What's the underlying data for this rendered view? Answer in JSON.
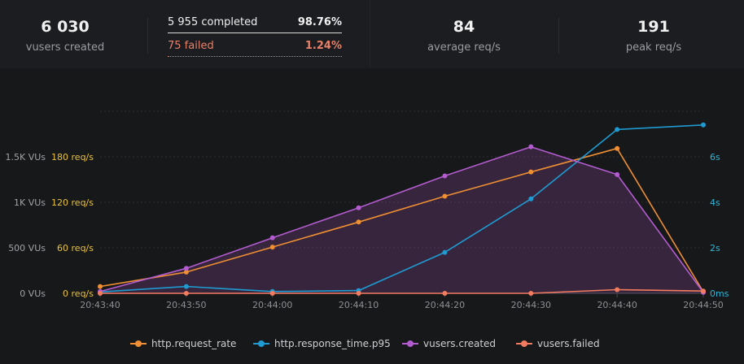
{
  "stats": {
    "vusers_created": {
      "value": "6 030",
      "label": "vusers created"
    },
    "completed": {
      "label": "5 955 completed",
      "percent": "98.76%"
    },
    "failed": {
      "label": "75 failed",
      "percent": "1.24%"
    },
    "average": {
      "value": "84",
      "label": "average req/s"
    },
    "peak": {
      "value": "191",
      "label": "peak req/s"
    }
  },
  "colors": {
    "request_rate": "#ef8f34",
    "response_time": "#1f9bd2",
    "vusers_created": "#b35ccf",
    "vusers_failed": "#f27c5f",
    "left_axis_vus": "#a0a2a7",
    "left_axis_req": "#e9c23c",
    "right_axis": "#2fb6d9"
  },
  "chart_data": {
    "type": "line",
    "x": [
      "20:43:40",
      "20:43:50",
      "20:44:00",
      "20:44:10",
      "20:44:20",
      "20:44:30",
      "20:44:40",
      "20:44:50"
    ],
    "axes": {
      "vus": {
        "ticks": [
          "0 VUs",
          "500 VUs",
          "1K VUs",
          "1.5K VUs"
        ],
        "range": [
          0,
          2000
        ]
      },
      "req": {
        "ticks": [
          "0 req/s",
          "60 req/s",
          "120 req/s",
          "180 req/s"
        ],
        "range": [
          0,
          240
        ]
      },
      "ms": {
        "ticks": [
          "0ms",
          "2s",
          "4s",
          "6s"
        ],
        "range": [
          0,
          8000
        ]
      }
    },
    "grid": true,
    "legend_position": "bottom",
    "series": [
      {
        "name": "http.request_rate",
        "axis": "req",
        "values": [
          9,
          28,
          61,
          94,
          128,
          160,
          191,
          2
        ]
      },
      {
        "name": "http.response_time.p95",
        "axis": "ms",
        "values": [
          60,
          300,
          80,
          120,
          1800,
          4150,
          7200,
          7400
        ]
      },
      {
        "name": "vusers.created",
        "axis": "vus",
        "values": [
          20,
          275,
          610,
          940,
          1290,
          1610,
          1305,
          10
        ]
      },
      {
        "name": "vusers.failed",
        "axis": "vus",
        "values": [
          0,
          0,
          0,
          0,
          0,
          0,
          40,
          25
        ]
      }
    ]
  }
}
